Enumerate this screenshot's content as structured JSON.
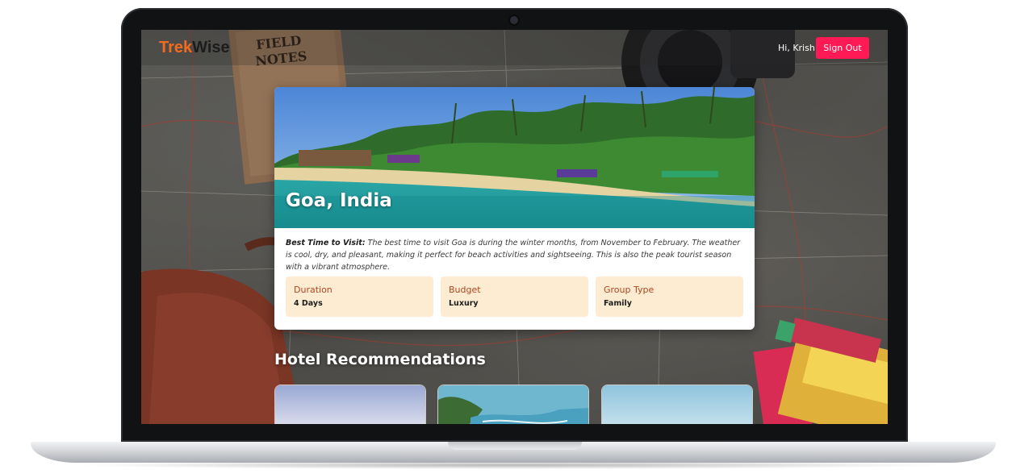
{
  "navbar": {
    "logo_part1": "Trek",
    "logo_part2": "Wise",
    "greeting": "Hi, Krish",
    "signout_label": "Sign Out"
  },
  "destination": {
    "title": "Goa, India",
    "best_time_label": "Best Time to Visit:",
    "best_time_text": " The best time to visit Goa is during the winter months, from November to February. The weather is cool, dry, and pleasant, making it perfect for beach activities and sightseeing. This is also the peak tourist season with a vibrant atmosphere."
  },
  "info_boxes": [
    {
      "label": "Duration",
      "value": "4 Days"
    },
    {
      "label": "Budget",
      "value": "Luxury"
    },
    {
      "label": "Group Type",
      "value": "Family"
    }
  ],
  "hotels": {
    "section_title": "Hotel Recommendations"
  },
  "colors": {
    "brand_orange": "#f46a1f",
    "signout_red": "#ff1a55",
    "info_bg": "#fdecd2",
    "info_label": "#b1461f"
  }
}
